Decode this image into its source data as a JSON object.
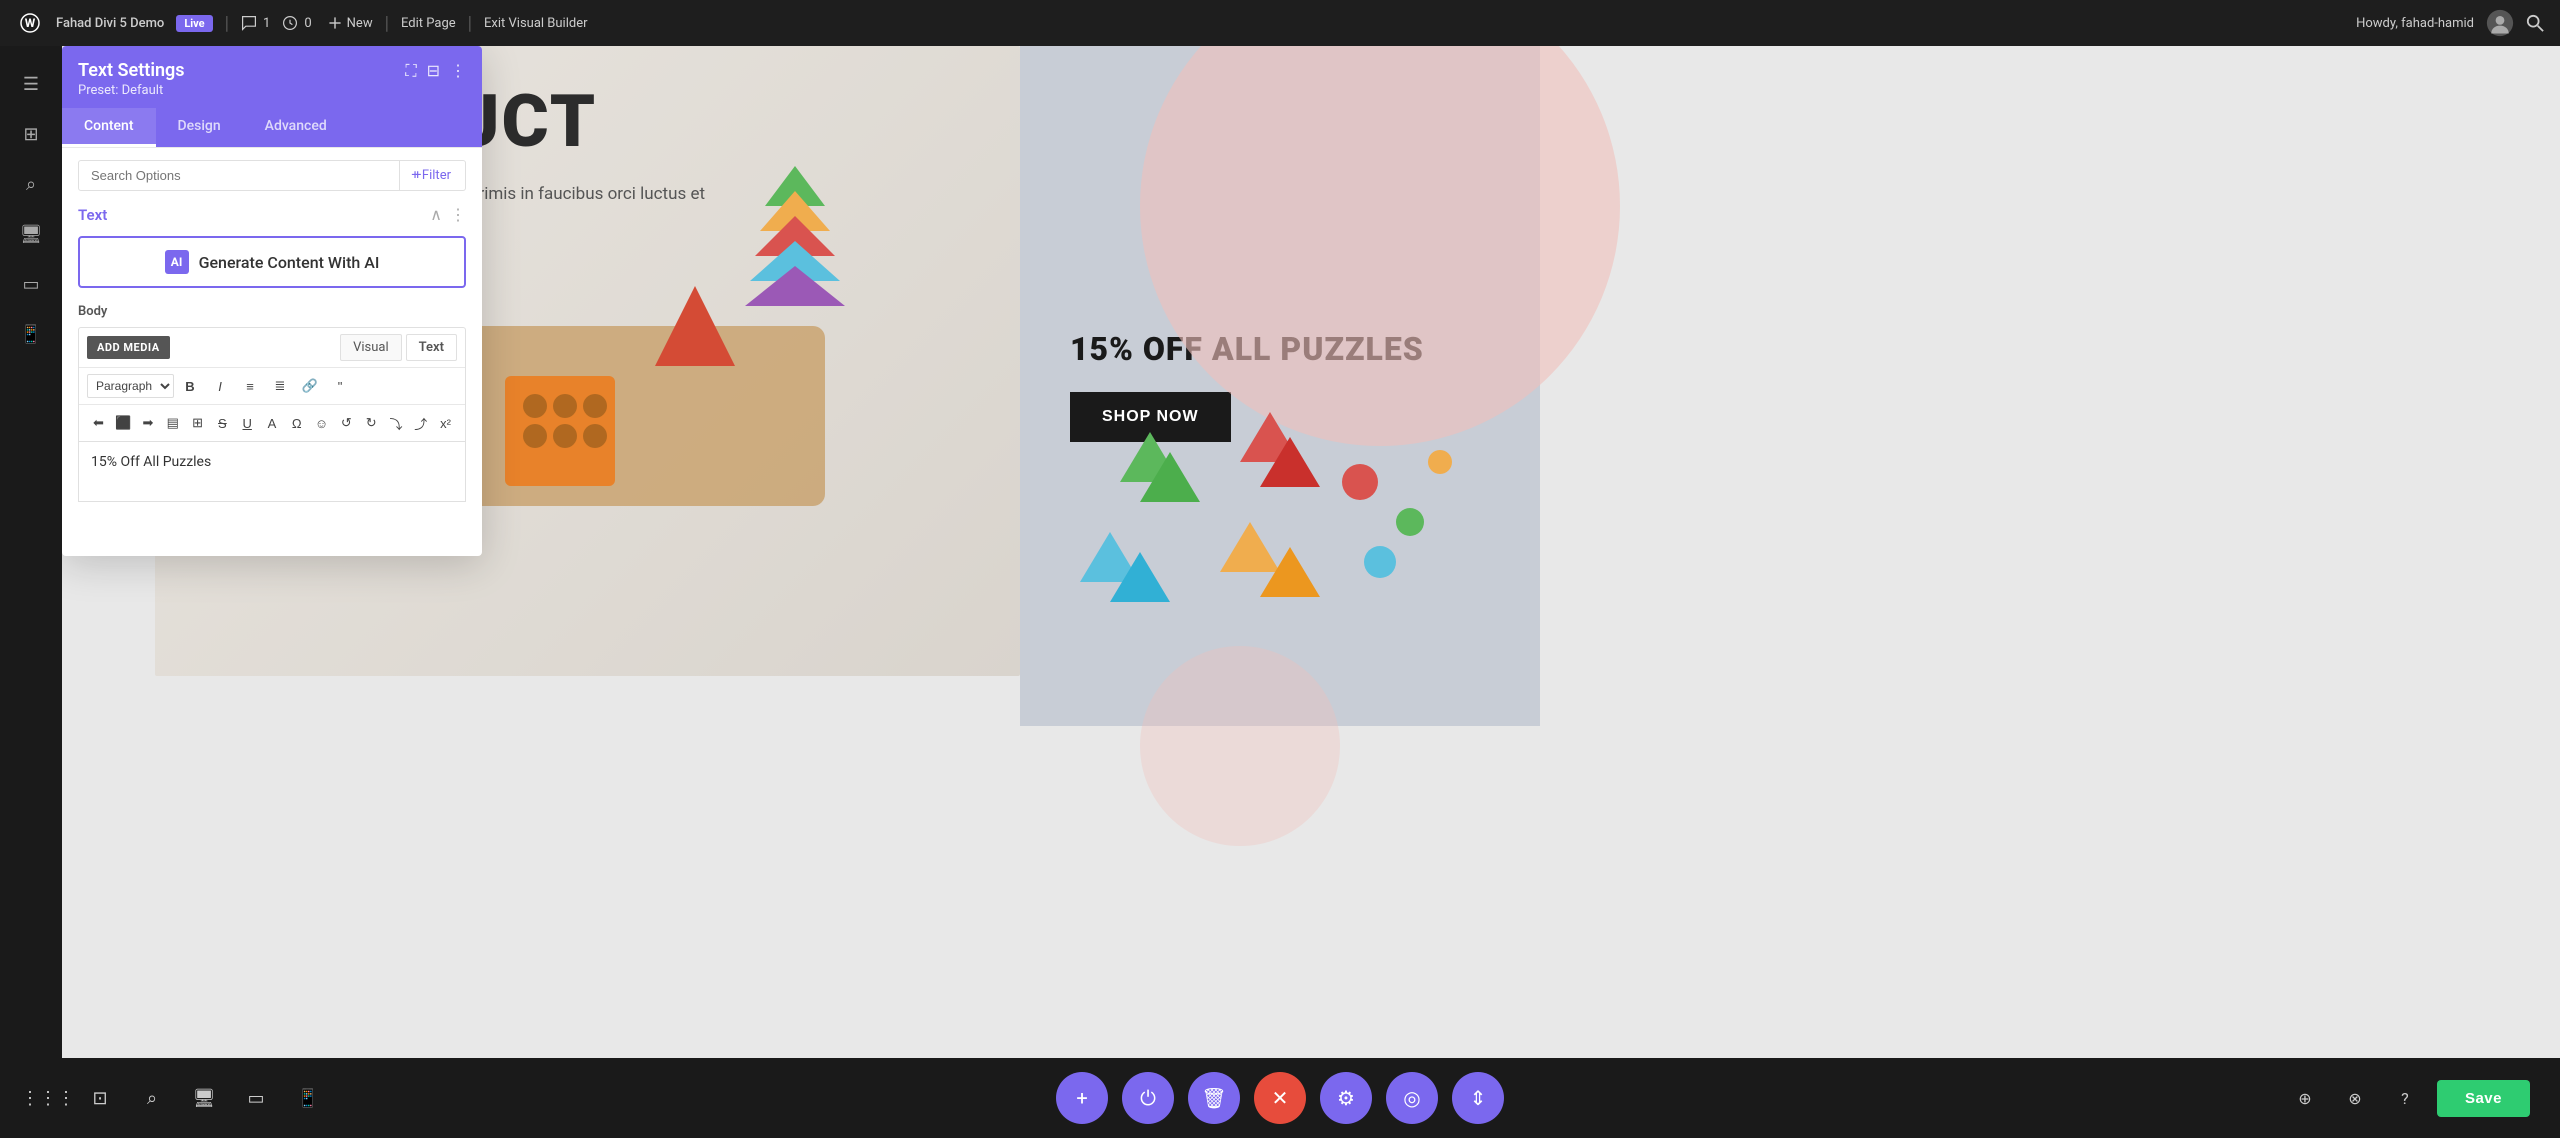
{
  "topbar": {
    "wp_logo": "⊕",
    "site_name": "Fahad Divi 5 Demo",
    "live_badge": "Live",
    "comments_count": "1",
    "updates_count": "0",
    "new_label": "New",
    "edit_page": "Edit Page",
    "exit_builder": "Exit Visual Builder",
    "howdy": "Howdy, fahad-hamid"
  },
  "panel": {
    "title": "Text Settings",
    "preset": "Preset: Default",
    "tabs": [
      "Content",
      "Design",
      "Advanced"
    ],
    "active_tab": "Content",
    "search_placeholder": "Search Options",
    "filter_label": "+ Filter",
    "section_title": "Text",
    "ai_button_label": "Generate Content With AI",
    "body_label": "Body",
    "add_media": "ADD MEDIA",
    "tab_visual": "Visual",
    "tab_text": "Text",
    "paragraph_label": "Paragraph",
    "editor_content": "15% Off All Puzzles"
  },
  "page": {
    "product_title": "D PRODUCT",
    "body_text": "et malesuada. Vestibulum ante ipsum primis in faucibus orci luctus et",
    "sale_title": "15% OFF ALL PUZZLES",
    "shop_now": "SHOP NOW"
  },
  "bottom_toolbar": {
    "save_label": "Save",
    "center_buttons": [
      "+",
      "⏻",
      "🗑",
      "✕",
      "⚙",
      "◎",
      "⇕"
    ]
  },
  "action_bar": {
    "cancel": "✕",
    "undo": "↺",
    "redo": "↻",
    "confirm": "✓"
  }
}
